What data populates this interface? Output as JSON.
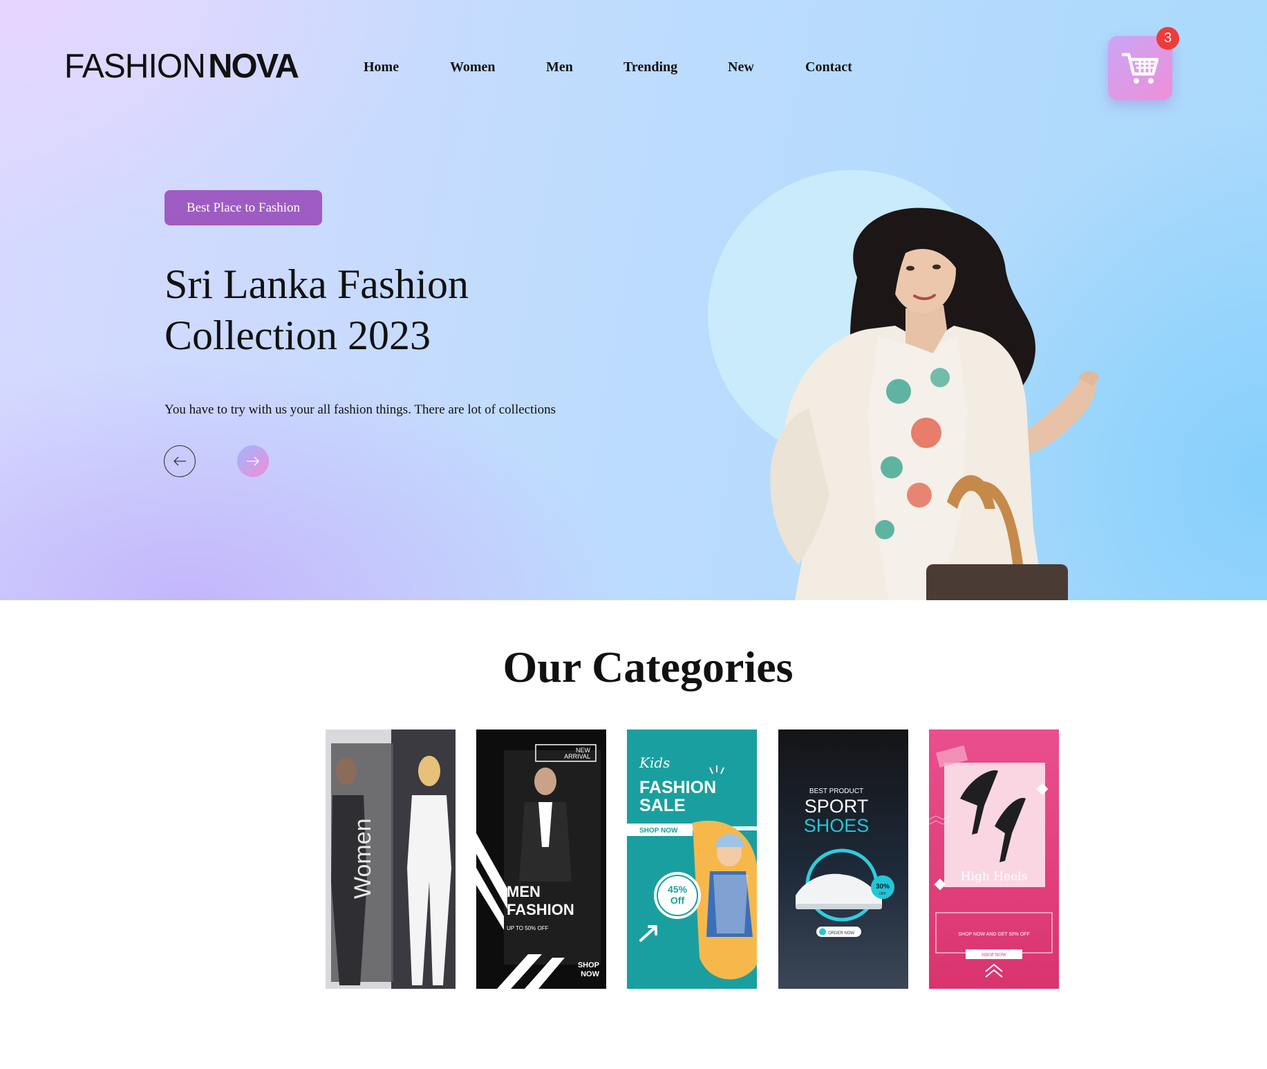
{
  "header": {
    "logo_light": "FASHION",
    "logo_bold": "NOVA",
    "nav": [
      "Home",
      "Women",
      "Men",
      "Trending",
      "New",
      "Contact"
    ],
    "cart_count": "3"
  },
  "hero": {
    "tag": "Best Place to Fashion",
    "title_line1": "Sri Lanka Fashion",
    "title_line2": "Collection 2023",
    "description": "You have to try with us your all fashion things. There are lot of collections"
  },
  "categories": {
    "title": "Our Categories",
    "cards": [
      {
        "label": "Women"
      },
      {
        "badge_line1": "NEW",
        "badge_line2": "ARRIVAL",
        "title_line1": "MEN",
        "title_line2": "FASHION",
        "subtitle": "UP TO 50% OFF",
        "cta_line1": "SHOP",
        "cta_line2": "NOW"
      },
      {
        "script": "Kids",
        "title_line1": "FASHION",
        "title_line2": "SALE",
        "cta": "SHOP NOW",
        "discount_line1": "45%",
        "discount_line2": "Off"
      },
      {
        "kicker": "BEST PRODUCT",
        "title_line1": "SPORT",
        "title_line2": "SHOES",
        "badge": "30%",
        "badge_sub": "OFF",
        "cta": "ORDER NOW"
      },
      {
        "title": "High Heels",
        "promo": "SHOP NOW AND GET 50% OFF",
        "cta": "SHOP NOW"
      }
    ]
  },
  "colors": {
    "accent_purple": "#9e5cc2",
    "cart_badge": "#ee3b3b",
    "kids_teal": "#1a9fa0",
    "heels_pink": "#e54a8a"
  },
  "icons": [
    "cart-icon",
    "arrow-left-icon",
    "arrow-right-icon",
    "chevron-up-icon"
  ]
}
